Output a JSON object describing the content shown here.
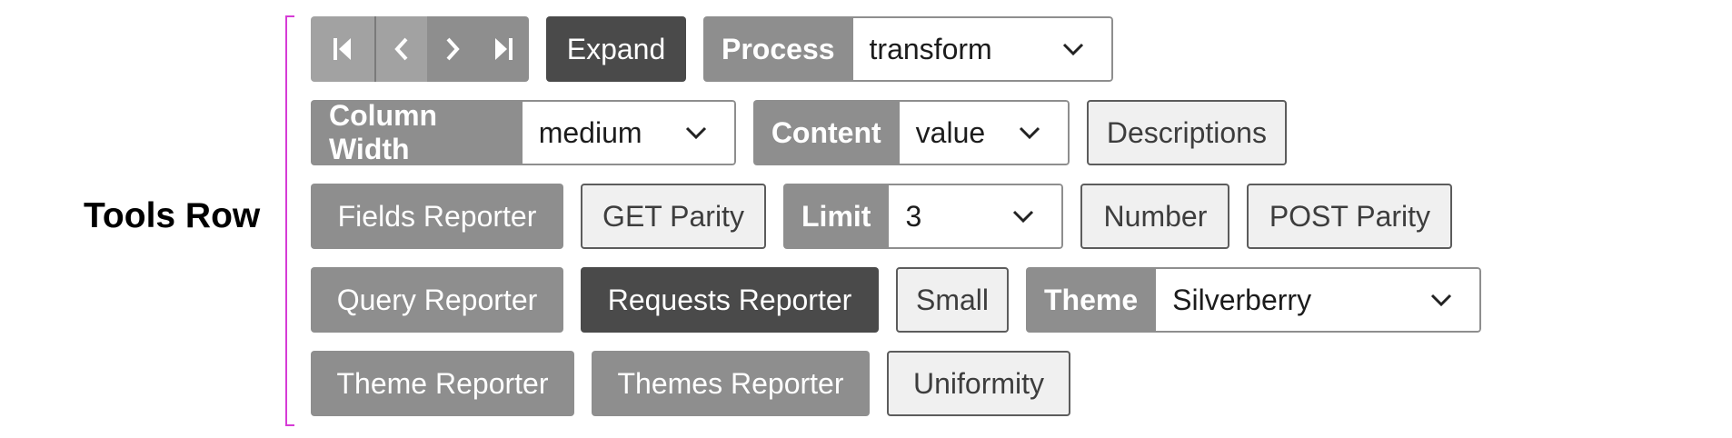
{
  "section": {
    "label": "Tools Row"
  },
  "nav_icons": [
    "first-page-icon",
    "previous-icon",
    "next-icon",
    "last-page-icon"
  ],
  "buttons": {
    "expand": "Expand",
    "descriptions": "Descriptions",
    "fields_reporter": "Fields Reporter",
    "get_parity": "GET Parity",
    "number": "Number",
    "post_parity": "POST Parity",
    "query_reporter": "Query Reporter",
    "requests_reporter": "Requests Reporter",
    "small": "Small",
    "theme_reporter": "Theme Reporter",
    "themes_reporter": "Themes Reporter",
    "uniformity": "Uniformity"
  },
  "selects": {
    "process": {
      "label": "Process",
      "value": "transform"
    },
    "column_width": {
      "label": "Column Width",
      "value": "medium"
    },
    "content": {
      "label": "Content",
      "value": "value"
    },
    "limit": {
      "label": "Limit",
      "value": "3"
    },
    "theme": {
      "label": "Theme",
      "value": "Silverberry"
    }
  },
  "colors": {
    "button_gray": "#8e8e8e",
    "button_dark": "#4a4a4a",
    "button_light": "#f0f0f0",
    "bracket": "#d63bd6"
  }
}
